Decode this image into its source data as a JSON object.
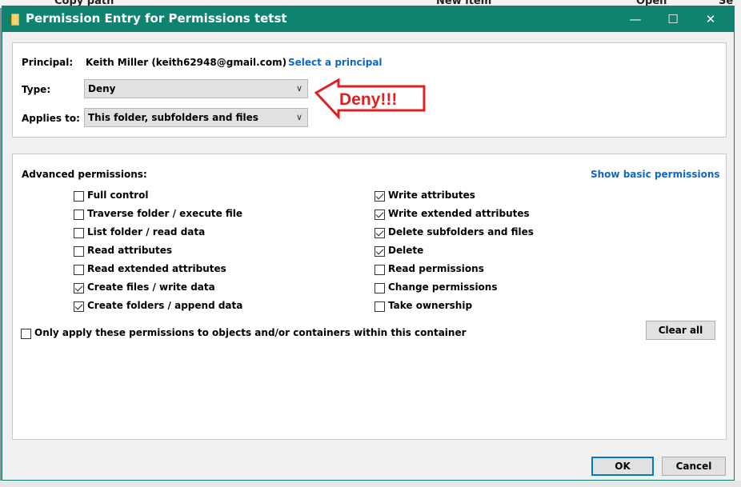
{
  "background": {
    "items": [
      "Copy path",
      "New item",
      "Open",
      "Se"
    ]
  },
  "dialog": {
    "title": "Permission Entry for Permissions tetst",
    "principal_label": "Principal:",
    "principal_value": "Keith Miller (keith62948@gmail.com)",
    "select_principal": "Select a principal",
    "type_label": "Type:",
    "type_value": "Deny",
    "applies_label": "Applies to:",
    "applies_value": "This folder, subfolders and files",
    "annotation": "Deny!!!",
    "advanced_label": "Advanced permissions:",
    "show_basic": "Show basic permissions",
    "permissions_left": [
      {
        "label": "Full control",
        "checked": false
      },
      {
        "label": "Traverse folder / execute file",
        "checked": false
      },
      {
        "label": "List folder / read data",
        "checked": false
      },
      {
        "label": "Read attributes",
        "checked": false
      },
      {
        "label": "Read extended attributes",
        "checked": false
      },
      {
        "label": "Create files / write data",
        "checked": true
      },
      {
        "label": "Create folders / append data",
        "checked": true
      }
    ],
    "permissions_right": [
      {
        "label": "Write attributes",
        "checked": true
      },
      {
        "label": "Write extended attributes",
        "checked": true
      },
      {
        "label": "Delete subfolders and files",
        "checked": true
      },
      {
        "label": "Delete",
        "checked": true
      },
      {
        "label": "Read permissions",
        "checked": false
      },
      {
        "label": "Change permissions",
        "checked": false
      },
      {
        "label": "Take ownership",
        "checked": false
      }
    ],
    "only_apply_label": "Only apply these permissions to objects and/or containers within this container",
    "only_apply_checked": false,
    "clear_all": "Clear all",
    "ok": "OK",
    "cancel": "Cancel"
  },
  "colors": {
    "titlebar": "#108270",
    "link": "#0b68c6",
    "annotation": "#e02020"
  },
  "icons": [
    "folder-icon",
    "minimize-icon",
    "maximize-icon",
    "close-icon",
    "chevron-down-icon",
    "arrow-annotation"
  ]
}
